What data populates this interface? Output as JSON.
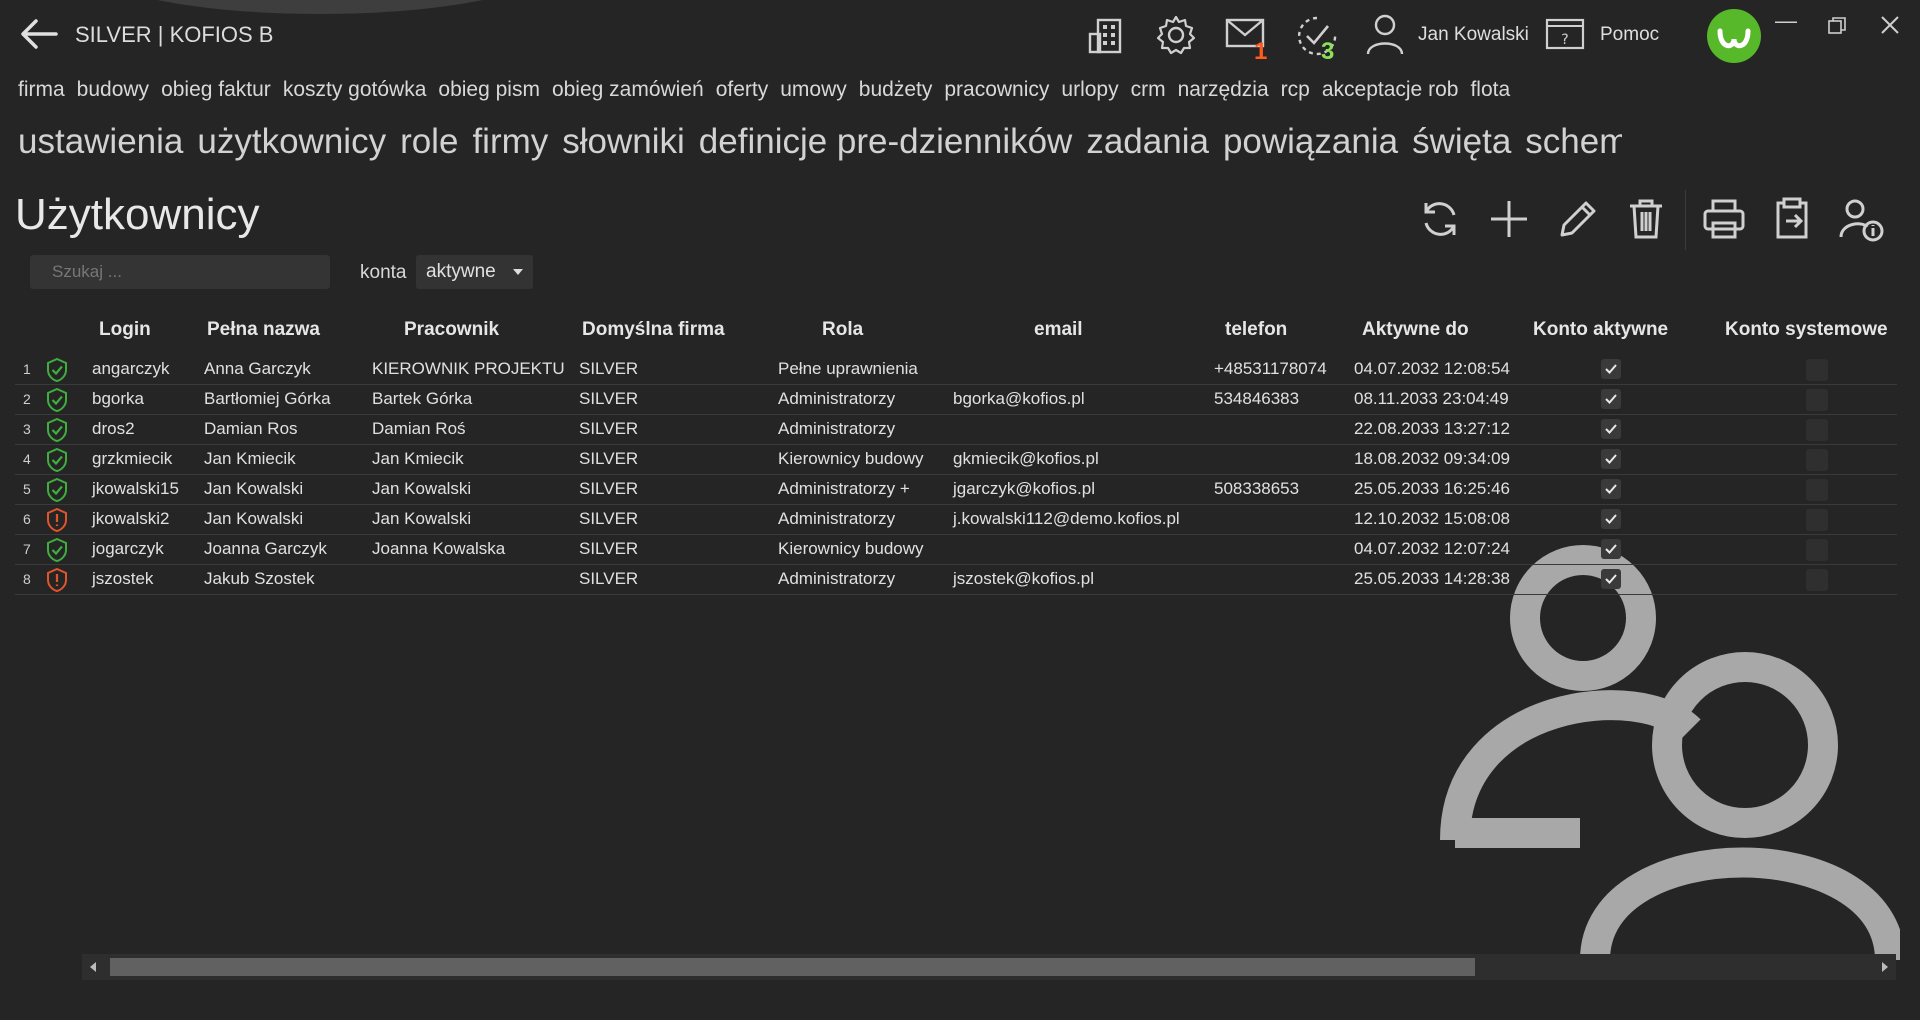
{
  "app": {
    "title": "SILVER | KOFIOS B"
  },
  "header": {
    "mail_badge": "1",
    "tasks_badge": "3",
    "username": "Jan Kowalski",
    "help_label": "Pomoc",
    "icons": [
      "back-arrow-icon",
      "building-icon",
      "gear-icon",
      "mail-icon",
      "tasks-icon",
      "user-icon",
      "help-icon",
      "logo-icon",
      "minimize-icon",
      "restore-icon",
      "close-icon"
    ],
    "accent_color": "#57b829"
  },
  "menu": {
    "main": [
      "firma",
      "budowy",
      "obieg faktur",
      "koszty gotówka",
      "obieg pism",
      "obieg zamówień",
      "oferty",
      "umowy",
      "budżety",
      "pracownicy",
      "urlopy",
      "crm",
      "narzędzia",
      "rcp",
      "akceptacje rob",
      "flota"
    ],
    "sub": [
      "ustawienia",
      "użytkownicy",
      "role",
      "firmy",
      "słowniki",
      "definicje pre-dzienników",
      "zadania",
      "powiązania",
      "święta",
      "schematy a"
    ],
    "active_sub": "użytkownicy"
  },
  "page": {
    "title": "Użytkownicy",
    "search_placeholder": "Szukaj ...",
    "konta_label": "konta",
    "konta_value": "aktywne",
    "toolbar": [
      "refresh-icon",
      "add-icon",
      "edit-icon",
      "delete-icon",
      "print-icon",
      "clipboard-export-icon",
      "user-info-icon"
    ]
  },
  "table": {
    "columns": [
      "Login",
      "Pełna nazwa",
      "Pracownik",
      "Domyślna firma",
      "Rola",
      "email",
      "telefon",
      "Aktywne do",
      "Konto aktywne",
      "Konto systemowe"
    ],
    "rows": [
      {
        "n": "1",
        "status": "ok",
        "login": "angarczyk",
        "full": "Anna Garczyk",
        "emp": "KIEROWNIK  PROJEKTU",
        "firm": "SILVER",
        "role": "Pełne uprawnienia",
        "email": "",
        "phone": "+48531178074",
        "until": "04.07.2032 12:08:54"
      },
      {
        "n": "2",
        "status": "ok",
        "login": "bgorka",
        "full": "Bartłomiej Górka",
        "emp": "Bartek Górka",
        "firm": "SILVER",
        "role": "Administratorzy",
        "email": "bgorka@kofios.pl",
        "phone": "534846383",
        "until": "08.11.2033 23:04:49"
      },
      {
        "n": "3",
        "status": "ok",
        "login": "dros2",
        "full": "Damian Ros",
        "emp": "Damian Roś",
        "firm": "SILVER",
        "role": "Administratorzy",
        "email": "",
        "phone": "",
        "until": "22.08.2033 13:27:12"
      },
      {
        "n": "4",
        "status": "ok",
        "login": "grzkmiecik",
        "full": "Jan Kmiecik",
        "emp": "Jan Kmiecik",
        "firm": "SILVER",
        "role": "Kierownicy budowy",
        "email": "gkmiecik@kofios.pl",
        "phone": "",
        "until": "18.08.2032 09:34:09"
      },
      {
        "n": "5",
        "status": "ok",
        "login": "jkowalski15",
        "full": "Jan Kowalski",
        "emp": "Jan Kowalski",
        "firm": "SILVER",
        "role": "Administratorzy +",
        "email": "jgarczyk@kofios.pl",
        "phone": "508338653",
        "until": "25.05.2033 16:25:46"
      },
      {
        "n": "6",
        "status": "warn",
        "login": "jkowalski2",
        "full": "Jan Kowalski",
        "emp": "Jan Kowalski",
        "firm": "SILVER",
        "role": "Administratorzy",
        "email": "j.kowalski112@demo.kofios.pl",
        "phone": "",
        "until": "12.10.2032 15:08:08"
      },
      {
        "n": "7",
        "status": "ok",
        "login": "jogarczyk",
        "full": "Joanna Garczyk",
        "emp": "Joanna  Kowalska",
        "firm": "SILVER",
        "role": "Kierownicy budowy",
        "email": "",
        "phone": "",
        "until": "04.07.2032 12:07:24"
      },
      {
        "n": "8",
        "status": "warn",
        "login": "jszostek",
        "full": "Jakub Szostek",
        "emp": "",
        "firm": "SILVER",
        "role": "Administratorzy",
        "email": "jszostek@kofios.pl",
        "phone": "",
        "until": "25.05.2033 14:28:38"
      }
    ]
  },
  "colors": {
    "ok": "#3fae3f",
    "warn": "#e0552b",
    "badge_mail": "#ff5a1f",
    "badge_tasks": "#8de05a"
  }
}
